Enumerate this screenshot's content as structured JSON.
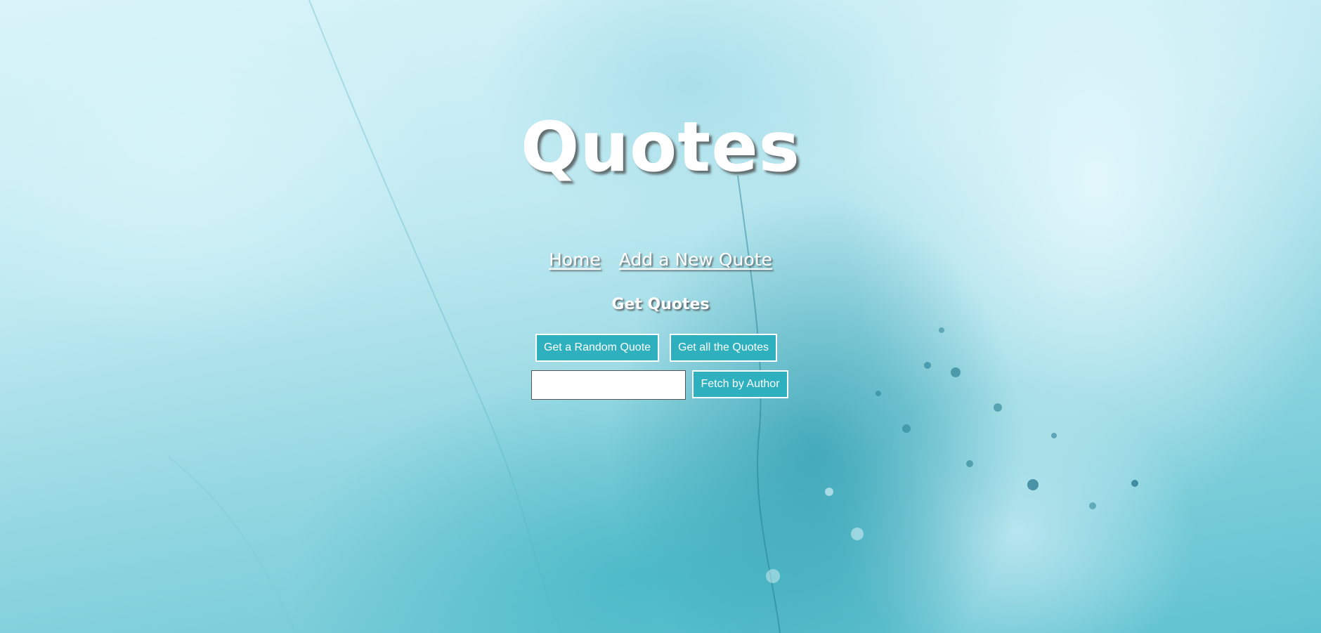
{
  "page": {
    "title": "Quotes",
    "background_accent": "#2fb0bf"
  },
  "nav": {
    "home": "Home",
    "add_new_quote": "Add a New Quote"
  },
  "section": {
    "heading": "Get Quotes"
  },
  "actions": {
    "random_quote_label": "Get a Random Quote",
    "all_quotes_label": "Get all the Quotes",
    "fetch_by_author_label": "Fetch by Author"
  },
  "author_search": {
    "value": "",
    "placeholder": ""
  }
}
